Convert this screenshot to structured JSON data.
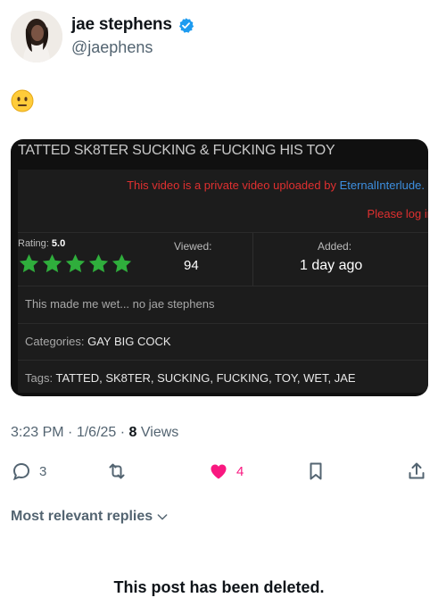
{
  "author": {
    "display_name": "jae stephens",
    "handle": "@jaephens"
  },
  "tweet": {
    "emoji": "😐"
  },
  "embed": {
    "title": "TATTED SK8TER SUCKING & FUCKING HIS TOY",
    "private_text": "This video is a private video uploaded by",
    "private_user": "EternalInterlude.",
    "login_text": "Please log in",
    "rating_label": "Rating:",
    "rating_value": "5.0",
    "rating_stars": 5,
    "viewed_label": "Viewed:",
    "viewed_value": "94",
    "added_label": "Added:",
    "added_value": "1 day ago",
    "description": "This made me wet... no jae stephens",
    "categories_label": "Categories:",
    "categories_value": "GAY BIG COCK",
    "tags_label": "Tags:",
    "tags_value": "TATTED, SK8TER, SUCKING, FUCKING, TOY, WET, JAE"
  },
  "meta": {
    "time": "3:23 PM",
    "date": "1/6/25",
    "views_count": "8",
    "views_label": "Views"
  },
  "actions": {
    "replies": "3",
    "likes": "4"
  },
  "replies_sort": "Most relevant replies",
  "deleted_notice": "This post has been deleted.",
  "colors": {
    "accent": "#1d9bf0",
    "like": "#f91880",
    "star": "#2fae3c",
    "alert": "#e03030"
  }
}
